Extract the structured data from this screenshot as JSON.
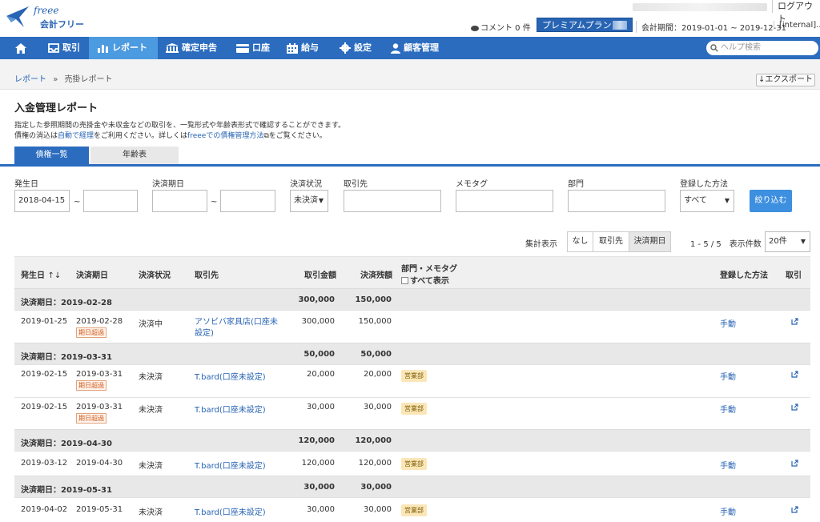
{
  "header": {
    "brand": "freee",
    "app_name": "会計フリー",
    "logout": "ログアウト",
    "comment": "コメント 0 件",
    "plan": "プレミアムプラン",
    "period": "会計期間：2019-01-01 ~ 2019-12-31",
    "internal": "[internal]..."
  },
  "nav": {
    "items": [
      {
        "label": "",
        "icon": "home-icon"
      },
      {
        "label": "取引",
        "icon": "inbox-icon"
      },
      {
        "label": "レポート",
        "icon": "bar-chart-icon"
      },
      {
        "label": "確定申告",
        "icon": "building-icon"
      },
      {
        "label": "口座",
        "icon": "card-icon"
      },
      {
        "label": "給与",
        "icon": "calendar-icon"
      },
      {
        "label": "設定",
        "icon": "gear-icon"
      },
      {
        "label": "顧客管理",
        "icon": "user-icon"
      }
    ],
    "help_placeholder": "ヘルプ検索"
  },
  "breadcrumb": {
    "parent": "レポート",
    "separator": "»",
    "current": "売掛レポート"
  },
  "export_label": "エクスポート",
  "page": {
    "title": "入金管理レポート",
    "desc1": "指定した参照期間の売掛金や未収金などの取引を、一覧形式や年齢表形式で確認することができます。",
    "desc2_a": "債権の消込は",
    "desc2_link1": "自動で経理",
    "desc2_b": "をご利用ください。詳しくは",
    "desc2_link2": "freeeでの債権管理方法",
    "desc2_c": "をご覧ください。"
  },
  "tabs": [
    "債権一覧",
    "年齢表"
  ],
  "filters": {
    "occurrence_label": "発生日",
    "occurrence_from": "2018-04-15",
    "occurrence_to": "",
    "tilde": "~",
    "due_label": "決済期日",
    "due_from": "",
    "due_to": "",
    "status_label": "決済状況",
    "status_value": "未決済",
    "partner_label": "取引先",
    "partner_value": "",
    "memo_label": "メモタグ",
    "memo_value": "",
    "dept_label": "部門",
    "dept_value": "",
    "method_label": "登録した方法",
    "method_value": "すべて",
    "apply_label": "絞り込む"
  },
  "aggregate": {
    "label": "集計表示",
    "options": [
      "なし",
      "取引先",
      "決済期日"
    ],
    "selected": "決済期日",
    "count": "1 - 5 / 5",
    "page_size_label": "表示件数",
    "page_size": "20件"
  },
  "table": {
    "headers": {
      "occurrence": "発生日",
      "sort": "↑↓",
      "due": "決済期日",
      "status": "決済状況",
      "partner": "取引先",
      "amount": "取引金額",
      "balance": "決済残額",
      "dept_memo": "部門・メモタグ",
      "show_all": "すべて表示",
      "method": "登録した方法",
      "deal": "取引"
    },
    "groups": [
      {
        "title": "決済期日：2019-02-28",
        "amount": "300,000",
        "balance": "150,000",
        "rows": [
          {
            "date": "2019-01-25",
            "due": "2019-02-28",
            "overdue": "期日超過",
            "status": "決済中",
            "partner": "アソビバ家具店(口座未設定)",
            "amount": "300,000",
            "balance": "150,000",
            "dept": "",
            "method": "手動"
          }
        ]
      },
      {
        "title": "決済期日：2019-03-31",
        "amount": "50,000",
        "balance": "50,000",
        "rows": [
          {
            "date": "2019-02-15",
            "due": "2019-03-31",
            "overdue": "期日超過",
            "status": "未決済",
            "partner": "T.bard(口座未設定)",
            "amount": "20,000",
            "balance": "20,000",
            "dept": "営業部",
            "method": "手動"
          },
          {
            "date": "2019-02-15",
            "due": "2019-03-31",
            "overdue": "期日超過",
            "status": "未決済",
            "partner": "T.bard(口座未設定)",
            "amount": "30,000",
            "balance": "30,000",
            "dept": "営業部",
            "method": "手動"
          }
        ]
      },
      {
        "title": "決済期日：2019-04-30",
        "amount": "120,000",
        "balance": "120,000",
        "rows": [
          {
            "date": "2019-03-12",
            "due": "2019-04-30",
            "overdue": "",
            "status": "未決済",
            "partner": "T.bard(口座未設定)",
            "amount": "120,000",
            "balance": "120,000",
            "dept": "営業部",
            "method": "手動"
          }
        ]
      },
      {
        "title": "決済期日：2019-05-31",
        "amount": "30,000",
        "balance": "30,000",
        "rows": [
          {
            "date": "2019-04-02",
            "due": "2019-05-31",
            "overdue": "",
            "status": "未決済",
            "partner": "T.bard(口座未設定)",
            "amount": "30,000",
            "balance": "30,000",
            "dept": "営業部",
            "method": "手動"
          }
        ]
      }
    ]
  },
  "colors": {
    "nav": "#2b6cbf",
    "nav_active": "#4c9ae0",
    "link": "#2864b4",
    "apply": "#3d8fe0",
    "dept_tag": "#fbe6b8",
    "overdue": "#d05a1a"
  }
}
